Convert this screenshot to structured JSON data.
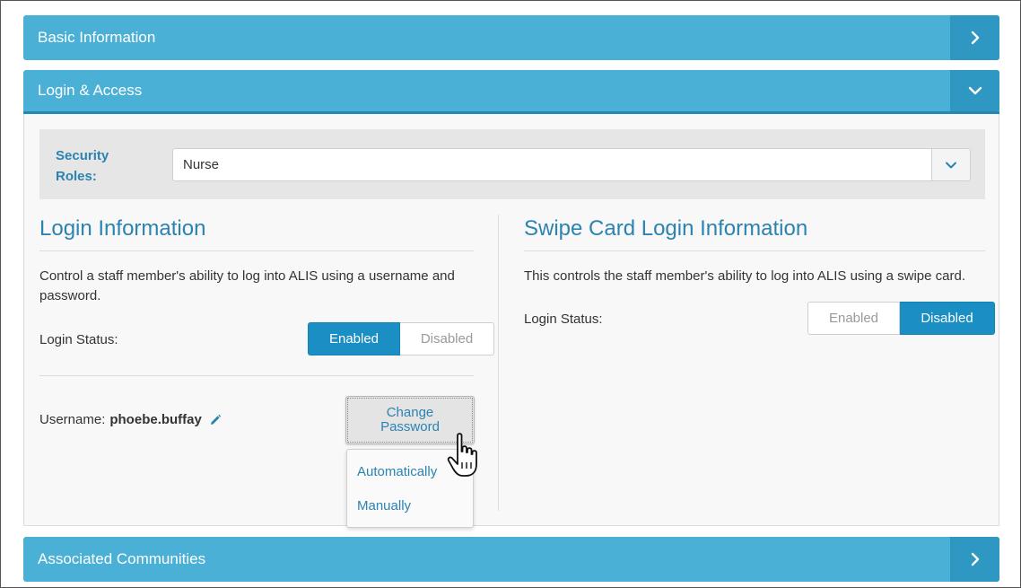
{
  "panels": {
    "basic": {
      "title": "Basic Information",
      "state": "collapsed"
    },
    "login": {
      "title": "Login & Access",
      "state": "expanded"
    },
    "communities": {
      "title": "Associated Communities",
      "state": "collapsed"
    }
  },
  "security_roles": {
    "label": "Security Roles:",
    "value": "Nurse"
  },
  "login_info": {
    "title": "Login Information",
    "description": "Control a staff member's ability to log into ALIS using a username and password.",
    "status_label": "Login Status:",
    "enabled_label": "Enabled",
    "disabled_label": "Disabled",
    "selected": "Enabled",
    "username_label": "Username:",
    "username_value": "phoebe.buffay",
    "change_password": {
      "line1": "Change",
      "line2": "Password"
    },
    "password_options": [
      "Automatically",
      "Manually"
    ]
  },
  "swipe_card": {
    "title": "Swipe Card Login Information",
    "description": "This controls the staff member's ability to log into ALIS using a swipe card.",
    "status_label": "Login Status:",
    "enabled_label": "Enabled",
    "disabled_label": "Disabled",
    "selected": "Disabled"
  },
  "colors": {
    "header": "#4bb0d6",
    "header_toggle": "#2e98c3",
    "accent_text": "#2b83b1",
    "active_button": "#1b8fc4"
  },
  "icons": {
    "collapsed_toggle": "chevron-right-icon",
    "expanded_toggle": "chevron-down-icon",
    "select_caret": "chevron-down-icon",
    "edit": "pencil-icon",
    "pointer": "hand-cursor-icon"
  }
}
